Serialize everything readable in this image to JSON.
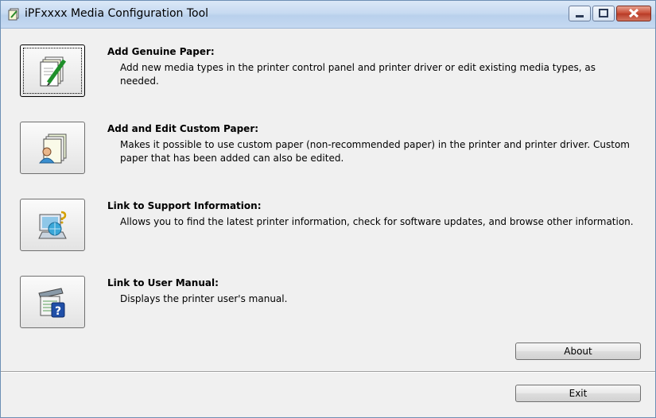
{
  "window": {
    "title": "iPFxxxx Media Configuration Tool"
  },
  "items": [
    {
      "title": "Add Genuine Paper:",
      "description": "Add new media types in the printer control panel and printer driver or edit existing media types, as needed.",
      "icon": "paper-pen-icon"
    },
    {
      "title": "Add and Edit Custom Paper:",
      "description": "Makes it possible to use custom paper (non-recommended paper) in the printer and printer driver. Custom paper that has been added can also be edited.",
      "icon": "paper-user-icon"
    },
    {
      "title": "Link to Support Information:",
      "description": "Allows you to find the latest printer information, check for software updates, and browse other information.",
      "icon": "support-globe-icon"
    },
    {
      "title": "Link to User Manual:",
      "description": "Displays the printer user's manual.",
      "icon": "manual-help-icon"
    }
  ],
  "buttons": {
    "about": "About",
    "exit": "Exit"
  }
}
